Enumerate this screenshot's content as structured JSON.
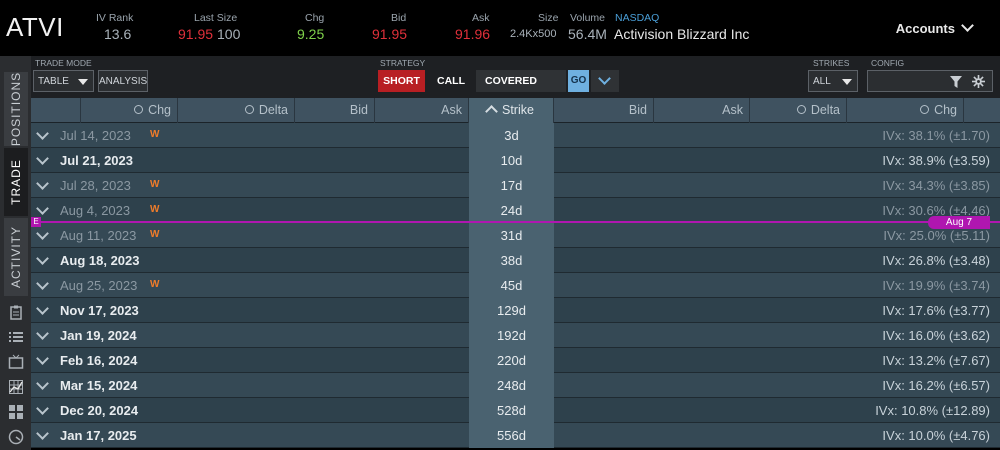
{
  "header": {
    "symbol": "ATVI",
    "iv_rank_label": "IV Rank",
    "iv_rank": "13.6",
    "last_size_label": "Last Size",
    "last": "91.95",
    "last_size": "100",
    "chg_label": "Chg",
    "chg": "9.25",
    "bid_label": "Bid",
    "bid": "91.95",
    "ask_label": "Ask",
    "ask": "91.96",
    "size_label": "Size",
    "size": "2.4Kx500",
    "volume_label": "Volume",
    "volume": "56.4M",
    "exchange": "NASDAQ",
    "company": "Activision Blizzard Inc",
    "accounts_label": "Accounts"
  },
  "sidebar": {
    "tabs": [
      "POSITIONS",
      "TRADE",
      "ACTIVITY"
    ],
    "active_tab": "TRADE"
  },
  "toolbar": {
    "trade_mode_label": "TRADE MODE",
    "trade_mode_value": "TABLE",
    "analysis_label": "ANALYSIS",
    "strategy_label": "STRATEGY",
    "short_label": "SHORT",
    "call_label": "CALL",
    "covered_label": "COVERED",
    "go_label": "GO",
    "strikes_label": "STRIKES",
    "strikes_value": "ALL",
    "config_label": "CONFIG"
  },
  "columns": {
    "left": [
      "Chg",
      "Delta",
      "Bid",
      "Ask"
    ],
    "strike": "Strike",
    "right": [
      "Bid",
      "Ask",
      "Delta",
      "Chg"
    ]
  },
  "expirations": [
    {
      "date": "Jul 14, 2023",
      "weekly": "W",
      "days": "3d",
      "ivx": "IVx: 38.1% (±1.70)",
      "bold": false
    },
    {
      "date": "Jul 21, 2023",
      "weekly": "",
      "days": "10d",
      "ivx": "IVx: 38.9% (±3.59)",
      "bold": true
    },
    {
      "date": "Jul 28, 2023",
      "weekly": "W",
      "days": "17d",
      "ivx": "IVx: 34.3% (±3.85)",
      "bold": false
    },
    {
      "date": "Aug 4, 2023",
      "weekly": "W",
      "days": "24d",
      "ivx": "IVx: 30.6% (±4.46)",
      "bold": false
    },
    {
      "date": "Aug 11, 2023",
      "weekly": "W",
      "days": "31d",
      "ivx": "IVx: 25.0% (±5.11)",
      "bold": false
    },
    {
      "date": "Aug 18, 2023",
      "weekly": "",
      "days": "38d",
      "ivx": "IVx: 26.8% (±3.48)",
      "bold": true
    },
    {
      "date": "Aug 25, 2023",
      "weekly": "W",
      "days": "45d",
      "ivx": "IVx: 19.9% (±3.74)",
      "bold": false
    },
    {
      "date": "Nov 17, 2023",
      "weekly": "",
      "days": "129d",
      "ivx": "IVx: 17.6% (±3.77)",
      "bold": true
    },
    {
      "date": "Jan 19, 2024",
      "weekly": "",
      "days": "192d",
      "ivx": "IVx: 16.0% (±3.62)",
      "bold": true
    },
    {
      "date": "Feb 16, 2024",
      "weekly": "",
      "days": "220d",
      "ivx": "IVx: 13.2% (±7.67)",
      "bold": true
    },
    {
      "date": "Mar 15, 2024",
      "weekly": "",
      "days": "248d",
      "ivx": "IVx: 16.2% (±6.57)",
      "bold": true
    },
    {
      "date": "Dec 20, 2024",
      "weekly": "",
      "days": "528d",
      "ivx": "IVx: 10.8% (±12.89)",
      "bold": true
    },
    {
      "date": "Jan 17, 2025",
      "weekly": "",
      "days": "556d",
      "ivx": "IVx: 10.0% (±4.76)",
      "bold": true
    }
  ],
  "marker": {
    "left_tag": "E",
    "right_tag": "Aug 7",
    "color": "#b016b0"
  },
  "colors": {
    "down_red": "#e0303a",
    "up_green": "#7fd14a",
    "short_button": "#b81f23",
    "go_button": "#6fb0e0",
    "weekly_badge": "#f07c2a"
  }
}
